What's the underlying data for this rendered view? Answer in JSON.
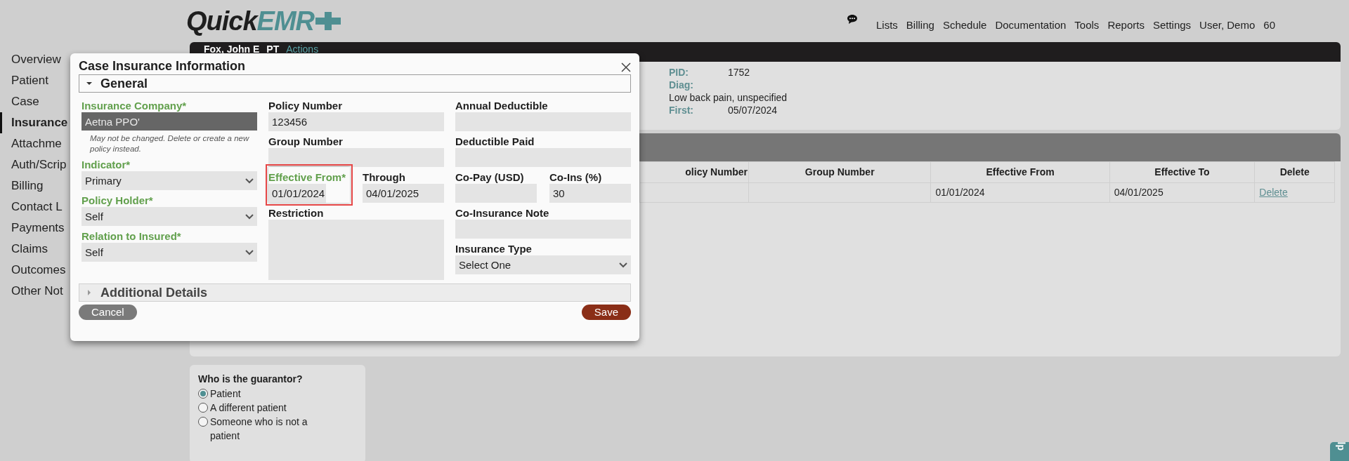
{
  "header": {
    "logo_main": "Quick",
    "logo_accent": "EMR",
    "nav": [
      "Lists",
      "Billing",
      "Schedule",
      "Documentation",
      "Tools",
      "Reports",
      "Settings",
      "User, Demo"
    ],
    "counter": "60"
  },
  "sidebar": {
    "items": [
      {
        "label": "Overview",
        "selected": false
      },
      {
        "label": "Patient",
        "selected": false
      },
      {
        "label": "Case",
        "selected": false
      },
      {
        "label": "Insurance",
        "selected": true
      },
      {
        "label": "Attachme",
        "selected": false
      },
      {
        "label": "Auth/Scrip",
        "selected": false
      },
      {
        "label": "Billing",
        "selected": false
      },
      {
        "label": "Contact L",
        "selected": false
      },
      {
        "label": "Payments",
        "selected": false
      },
      {
        "label": "Claims",
        "selected": false
      },
      {
        "label": "Outcomes",
        "selected": false
      },
      {
        "label": "Other Not",
        "selected": false
      }
    ]
  },
  "patient_bar": {
    "name": "Fox, John E",
    "discipline": "PT",
    "actions": "Actions"
  },
  "patient_info": [
    {
      "label": "PID:",
      "value": "1752"
    },
    {
      "label": "Diag:",
      "value": "Low back pain, unspecified"
    },
    {
      "label": "First:",
      "value": "05/07/2024"
    }
  ],
  "table": {
    "columns": [
      "olicy Number",
      "Group Number",
      "Effective From",
      "Effective To",
      "Delete"
    ],
    "rows": [
      [
        "",
        "",
        "01/01/2024",
        "04/01/2025",
        "Delete"
      ]
    ]
  },
  "guarantor": {
    "question": "Who is the guarantor?",
    "options": [
      {
        "label": "Patient",
        "selected": true
      },
      {
        "label": "A different patient",
        "selected": false
      },
      {
        "label": "Someone who is not a patient",
        "selected": false
      }
    ]
  },
  "help_tab": "lp",
  "modal": {
    "title": "Case Insurance Information",
    "sections": [
      {
        "label": "General",
        "expanded": true
      },
      {
        "label": "Additional Details",
        "expanded": false
      }
    ],
    "columns": [
      [
        [
          {
            "label": "Insurance Company*",
            "required": true,
            "kind": "locked",
            "value": "Aetna PPO'",
            "note": "May not be changed. Delete or create a new policy instead."
          }
        ],
        [
          {
            "label": "Indicator*",
            "required": true,
            "kind": "select",
            "value": "Primary"
          }
        ],
        [
          {
            "label": "Policy Holder*",
            "required": true,
            "kind": "select",
            "value": "Self"
          }
        ],
        [
          {
            "label": "Relation to Insured*",
            "required": true,
            "kind": "select",
            "value": "Self"
          }
        ]
      ],
      [
        [
          {
            "label": "Policy Number",
            "required": false,
            "kind": "input",
            "value": "123456"
          }
        ],
        [
          {
            "label": "Group Number",
            "required": false,
            "kind": "input"
          }
        ],
        [
          {
            "label": "Effective From*",
            "required": true,
            "kind": "input",
            "value": "01/01/2024",
            "highlighted": true
          },
          {
            "label": "Through",
            "required": false,
            "kind": "input",
            "value": "04/01/2025"
          }
        ],
        [
          {
            "label": "Restriction",
            "required": false,
            "kind": "textarea"
          }
        ]
      ],
      [
        [
          {
            "label": "Annual Deductible",
            "required": false,
            "kind": "input"
          }
        ],
        [
          {
            "label": "Deductible Paid",
            "required": false,
            "kind": "input"
          }
        ],
        [
          {
            "label": "Co-Pay (USD)",
            "required": false,
            "kind": "input"
          },
          {
            "label": "Co-Ins (%)",
            "required": false,
            "kind": "input",
            "value": "30"
          }
        ],
        [
          {
            "label": "Co-Insurance Note",
            "required": false,
            "kind": "input"
          }
        ],
        [
          {
            "label": "Insurance Type",
            "required": false,
            "kind": "select",
            "value": "Select One"
          }
        ]
      ]
    ],
    "buttons": [
      {
        "label": "Cancel",
        "kind": "secondary"
      },
      {
        "label": "Save",
        "kind": "primary"
      }
    ]
  }
}
